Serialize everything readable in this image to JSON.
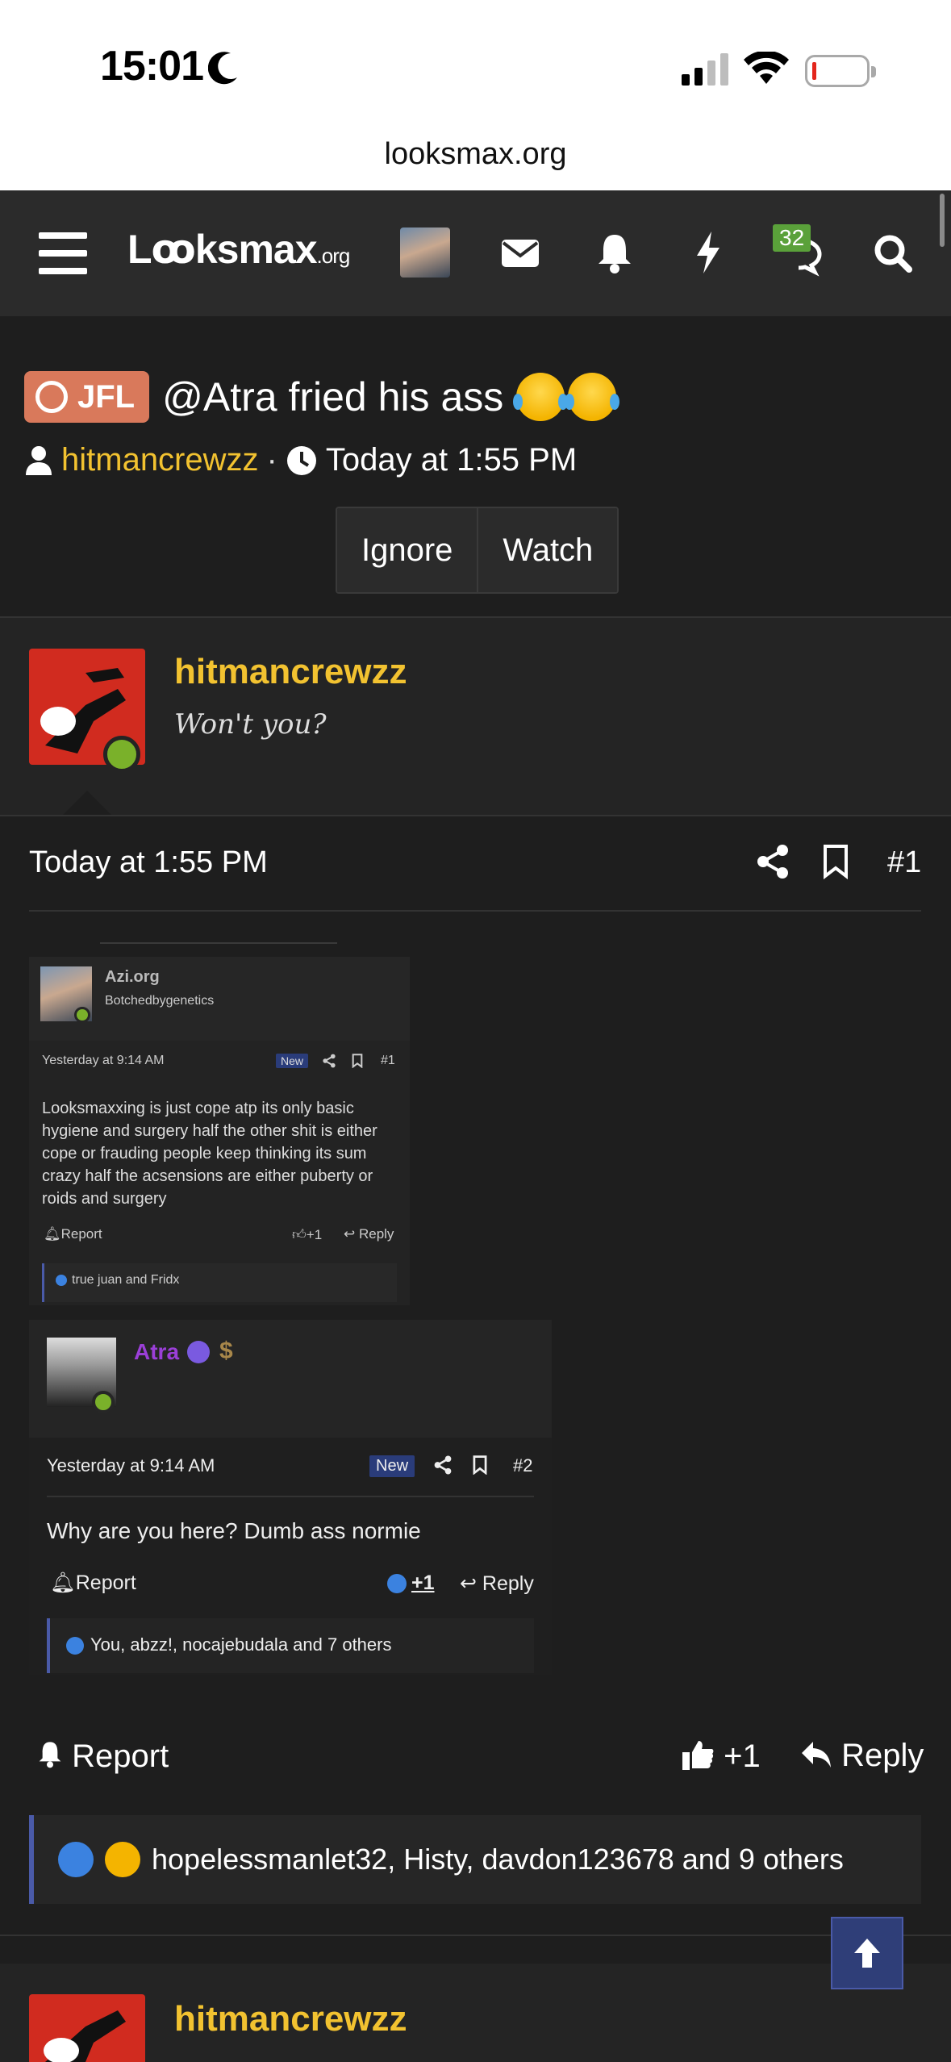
{
  "status_bar": {
    "time": "15:01"
  },
  "browser": {
    "url": "looksmax.org"
  },
  "nav": {
    "logo_main": "Lꝏksmax",
    "logo_suffix": ".org",
    "conversations_badge": "32"
  },
  "thread": {
    "prefix": "JFL",
    "title": "@Atra fried his ass",
    "author": "hitmancrewzz",
    "separator": "·",
    "date": "Today at 1:55 PM",
    "buttons": {
      "ignore": "Ignore",
      "watch": "Watch"
    }
  },
  "post": {
    "username": "hitmancrewzz",
    "user_title": "Won't you?",
    "date": "Today at 1:55 PM",
    "number": "#1",
    "report": "Report",
    "like_count": "+1",
    "reply": "Reply",
    "reactions": "hopelessmanlet32, Histy, davdon123678 and 9 others"
  },
  "embed1": {
    "name": "Azi.org",
    "subtitle": "Botchedbygenetics",
    "date": "Yesterday at 9:14 AM",
    "new_label": "New",
    "number": "#1",
    "body": "Looksmaxxing is just cope atp its only basic hygiene and surgery half the other shit is either cope or frauding people keep thinking its sum crazy half the acsensions are either puberty or roids and surgery",
    "report": "Report",
    "like": "+1",
    "reply": "Reply",
    "reactions": "true juan and Fridx"
  },
  "embed2": {
    "name": "Atra",
    "dollar": "$",
    "date": "Yesterday at 9:14 AM",
    "new_label": "New",
    "number": "#2",
    "body": "Why are you here? Dumb ass normie",
    "report": "Report",
    "like": "+1",
    "reply": "Reply",
    "reactions": "You, abzz!, nocajebudala and 7 others"
  },
  "next_post": {
    "username": "hitmancrewzz"
  },
  "colors": {
    "accent_username": "#f2c230",
    "prefix_bg": "#d9795b",
    "online": "#7ab12a",
    "reaction_border": "#4a5aa8",
    "atra_name": "#9b3fd8"
  }
}
